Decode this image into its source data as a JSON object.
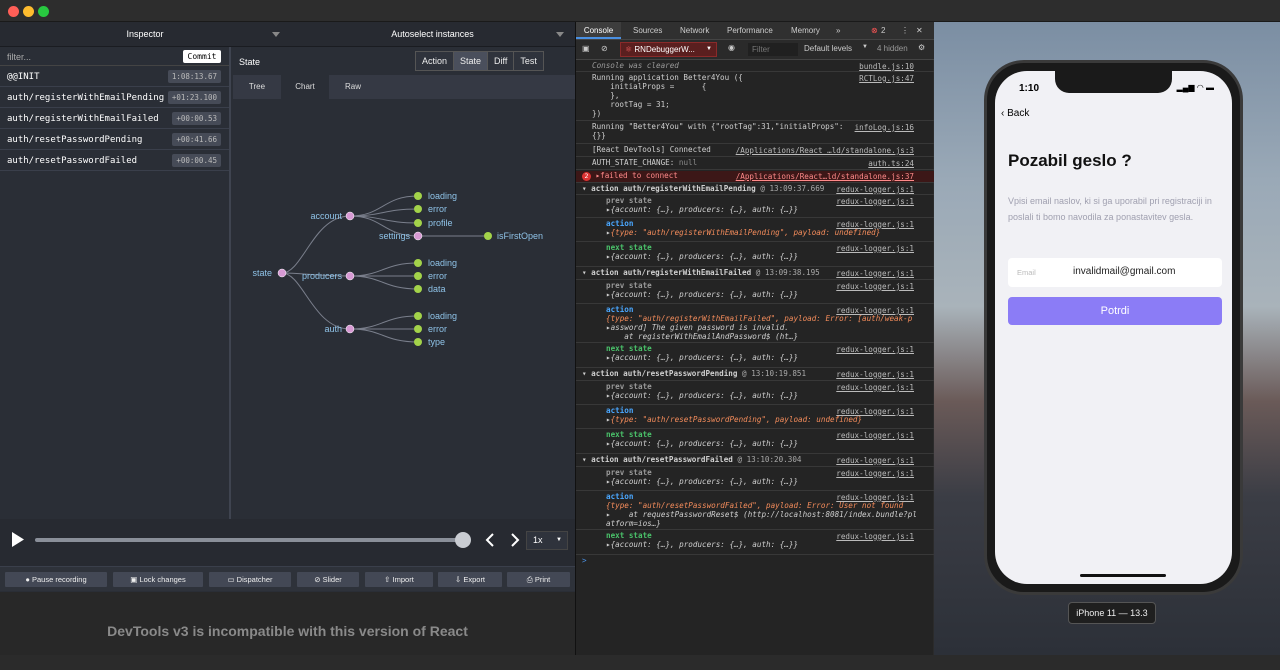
{
  "window": {
    "traffic_lights": [
      "#ff5f57",
      "#febc2e",
      "#28c840"
    ]
  },
  "inspector": {
    "header_left": "Inspector",
    "header_right": "Autoselect instances",
    "filter_placeholder": "filter...",
    "commit_label": "Commit",
    "actions": [
      {
        "name": "@@INIT",
        "time": "1:08:13.67"
      },
      {
        "name": "auth/registerWithEmailPending",
        "time": "+01:23.100"
      },
      {
        "name": "auth/registerWithEmailFailed",
        "time": "+00:00.53"
      },
      {
        "name": "auth/resetPasswordPending",
        "time": "+00:41.66"
      },
      {
        "name": "auth/resetPasswordFailed",
        "time": "+00:00.45"
      }
    ],
    "state_label": "State",
    "mode_buttons": [
      "Action",
      "State",
      "Diff",
      "Test"
    ],
    "sub_tabs": [
      "Tree",
      "Chart",
      "Raw"
    ],
    "tree": {
      "root": "state",
      "account": "account",
      "account_children": [
        "loading",
        "error",
        "profile"
      ],
      "settings": "settings",
      "settings_child": "isFirstOpen",
      "producers": "producers",
      "producers_children": [
        "loading",
        "error",
        "data"
      ],
      "auth": "auth",
      "auth_children": [
        "loading",
        "error",
        "type"
      ]
    },
    "speed": "1x",
    "bottom_buttons": [
      "Pause recording",
      "Lock changes",
      "Dispatcher",
      "Slider",
      "Import",
      "Export",
      "Print"
    ],
    "incompatible_message": "DevTools v3 is incompatible with this version of React"
  },
  "console": {
    "tabs": [
      "Console",
      "Sources",
      "Network",
      "Performance",
      "Memory",
      "»"
    ],
    "error_count": "2",
    "context": "RNDebuggerW...",
    "filter_placeholder": "Filter",
    "levels": "Default levels",
    "hidden": "4 hidden",
    "lines": {
      "cleared": "Console was cleared",
      "cleared_src": "bundle.js:10",
      "running1a": "Running application Better4You ({",
      "running1b": "    initialProps =      {",
      "running1c": "    },",
      "running1d": "    rootTag = 31;",
      "running1e": "})",
      "running1_src": "RCTLog.js:47",
      "running2a": "Running \"Better4You\" with {\"rootTag\":31,\"initialProps\":",
      "running2b": "{}}",
      "running2_src": "infoLog.js:16",
      "devtools": "[React DevTools] Connected",
      "devtools_src": "/Applications/React …ld/standalone.js:3",
      "authchange": "AUTH_STATE_CHANGE:",
      "authchange_val": "null",
      "authchange_src": "auth.ts:24",
      "failed": "failed to connect",
      "failed_badge": "2",
      "failed_src": "/Applications/React…ld/standalone.js:37",
      "logger_src": "redux-logger.js:1",
      "g1": "action auth/registerWithEmailPending",
      "g1_time": "@ 13:09:37.669",
      "g2": "action auth/registerWithEmailFailed",
      "g2_time": "@ 13:09:38.195",
      "g3": "action auth/resetPasswordPending",
      "g3_time": "@ 13:10:19.851",
      "g4": "action auth/resetPasswordFailed",
      "g4_time": "@ 13:10:20.304",
      "prev": "prev state",
      "act": "action",
      "next": "next state",
      "state_obj": "{account: {…}, producers: {…}, auth: {…}}",
      "a1": "{type: \"auth/registerWithEmailPending\", payload: undefined}",
      "a2a": "{type: \"auth/registerWithEmailFailed\", payload: Error: [auth/weak-p",
      "a2b": "assword] The given password is invalid.",
      "a2c": "    at registerWithEmailAndPassword$ (ht…}",
      "a3": "{type: \"auth/resetPasswordPending\", payload: undefined}",
      "a4a": "{type: \"auth/resetPasswordFailed\", payload: Error: User not found",
      "a4b": "    at requestPasswordReset$ (http://localhost:8081/index.bundle?pl",
      "a4c": "atform=ios…}",
      "prompt": ">"
    }
  },
  "simulator": {
    "time": "1:10",
    "back": "Back",
    "title": "Pozabil geslo ?",
    "description": "Vpisi email naslov, ki si ga uporabil pri registraciji in poslali ti bomo navodila za ponastavitev gesla.",
    "email_label": "Email",
    "email_value": "invalidmail@gmail.com",
    "submit": "Potrdi",
    "device": "iPhone 11 — 13.3",
    "accent": "#8b7cf6"
  }
}
